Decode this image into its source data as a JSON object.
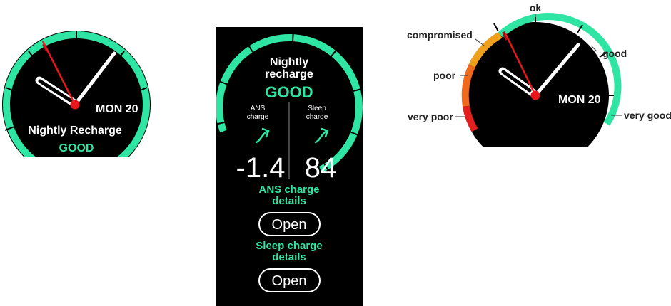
{
  "colors": {
    "accent": "#2fe5a3",
    "needle_red": "#e8171c",
    "screen_bg": "#000000",
    "very_poor": "#e21e1e",
    "poor": "#ef6a1c",
    "compromised": "#f0a11c",
    "ok": "#2fe5a3"
  },
  "left_watch": {
    "date": "MON 20",
    "title": "Nightly Recharge",
    "status": "GOOD"
  },
  "middle_watch": {
    "title_line1": "Nightly",
    "title_line2": "recharge",
    "status": "GOOD",
    "ans": {
      "label_line1": "ANS",
      "label_line2": "charge",
      "trend_icon": "arrow-up-right-icon",
      "value": "-1.4"
    },
    "sleep": {
      "label_line1": "Sleep",
      "label_line2": "charge",
      "trend_icon": "arrow-up-right-icon",
      "value": "84"
    },
    "ans_details_line1": "ANS charge",
    "ans_details_line2": "details",
    "open_button_1": "Open",
    "sleep_details_line1": "Sleep charge",
    "sleep_details_line2": "details",
    "open_button_2": "Open"
  },
  "right_watch": {
    "date": "MON 20",
    "scale": {
      "very_poor": "very poor",
      "poor": "poor",
      "compromised": "compromised",
      "ok": "ok",
      "good": "good",
      "very_good": "very good"
    }
  }
}
